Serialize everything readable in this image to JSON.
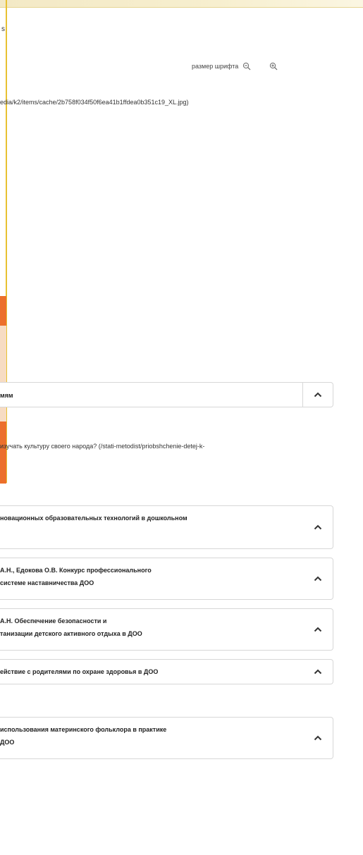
{
  "breadcrumb": "s",
  "font_size": {
    "label": "размер шрифта"
  },
  "image_link": "edia/k2/items/cache/2b758f034f50f6ea41b1ffdea0b351c19_XL.jpg)",
  "section": {
    "title": "мям"
  },
  "paragraph": "изучать культуру своего народа? (/stati-metodist/priobshchenie-detej-k-",
  "items": [
    {
      "line1": "новационных образовательных технологий в дошкольном",
      "line2": ""
    },
    {
      "line1": "А.Н., Едокова О.В. Конкурс профессионального",
      "line2": "системе наставничества ДОО"
    },
    {
      "line1": "А.Н. Обеспечение безопасности и",
      "line2": "танизации детского активного отдыха в ДОО"
    },
    {
      "line1": "ействие с родителями по охране здоровья в ДОО",
      "line2": ""
    },
    {
      "line1": "использования материнского фольклора в практике",
      "line2": "ДОО"
    }
  ],
  "colors": {
    "accent_orange": "#ec6f2b",
    "accent_yellow": "#e8c132"
  },
  "icons": {
    "zoom_out": "zoom-out-icon",
    "zoom_in": "zoom-in-icon",
    "toggle": "chevron-up-icon"
  }
}
